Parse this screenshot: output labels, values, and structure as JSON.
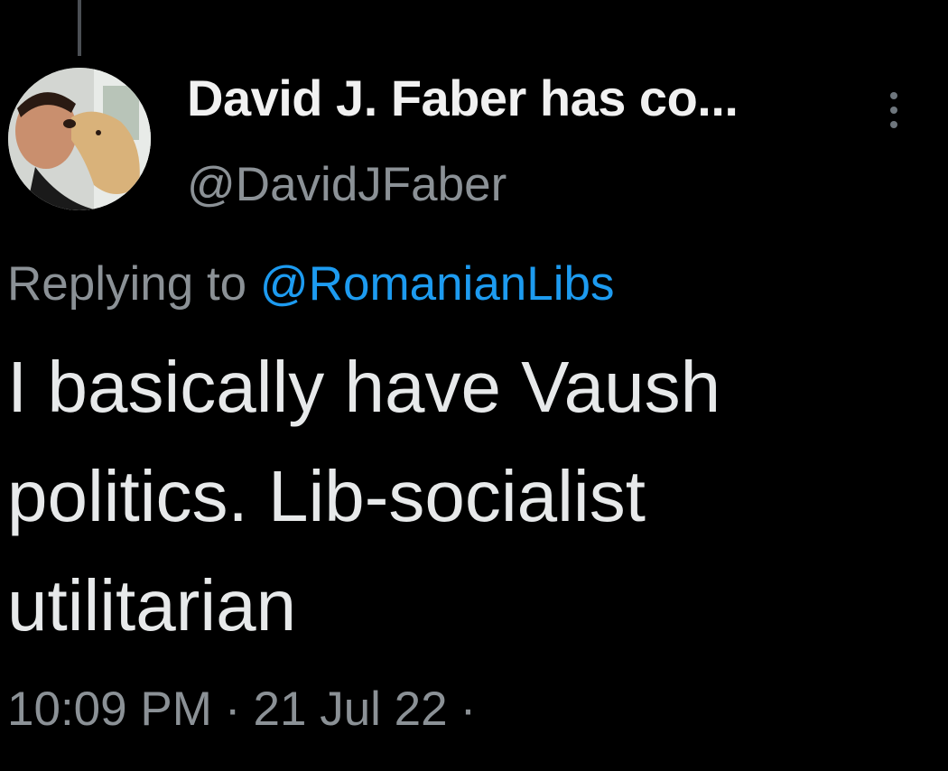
{
  "tweet": {
    "display_name": "David J. Faber has co...",
    "handle": "@DavidJFaber",
    "replying_prefix": "Replying to",
    "replying_mention": "@RomanianLibs",
    "body_lines": [
      "I basically have Vaush",
      "politics. Lib-socialist",
      "utilitarian"
    ],
    "time": "10:09 PM",
    "date": "21 Jul 22",
    "separator": "·"
  },
  "icons": {
    "more": "more-vertical-icon"
  },
  "colors": {
    "background": "#000000",
    "text": "#e7e9ea",
    "secondary_text": "#8b9196",
    "link": "#1d9bf0"
  }
}
